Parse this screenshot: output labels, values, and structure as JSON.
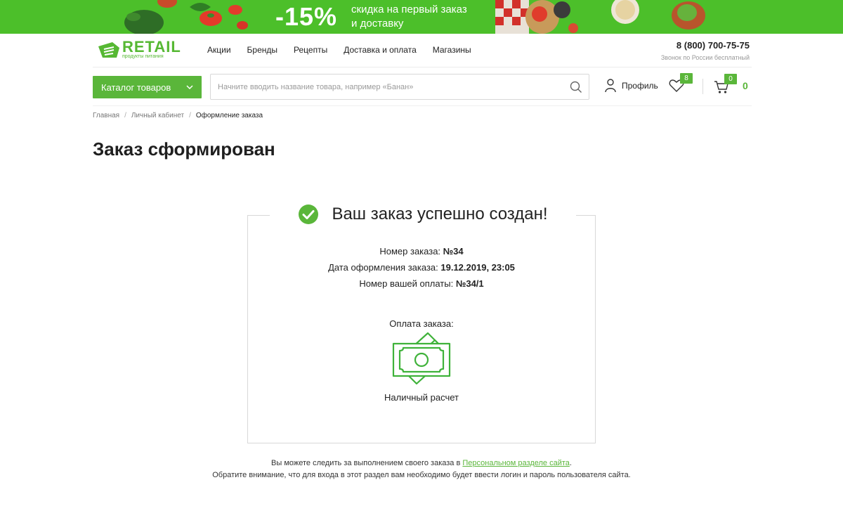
{
  "banner": {
    "discount": "-15%",
    "text_line1": "скидка на первый заказ",
    "text_line2": "и доставку"
  },
  "header": {
    "logo_name": "RETAIL",
    "logo_tagline": "продукты питания",
    "nav": [
      "Акции",
      "Бренды",
      "Рецепты",
      "Доставка и оплата",
      "Магазины"
    ],
    "phone": "8 (800) 700-75-75",
    "phone_note": "Звонок по России бесплатный"
  },
  "toolbar": {
    "catalog_label": "Каталог товаров",
    "search_placeholder": "Начните вводить название товара, например «Банан»",
    "profile_label": "Профиль",
    "favorites_count": "8",
    "cart_count": "0",
    "cart_total": "0"
  },
  "breadcrumb": [
    "Главная",
    "Личный кабинет",
    "Оформление заказа"
  ],
  "page_title": "Заказ сформирован",
  "order": {
    "success_title": "Ваш заказ успешно создан!",
    "number_label": "Номер заказа:",
    "number_value": "№34",
    "date_label": "Дата оформления заказа:",
    "date_value": "19.12.2019, 23:05",
    "payment_no_label": "Номер вашей оплаты:",
    "payment_no_value": "№34/1",
    "payment_label": "Оплата заказа:",
    "payment_method": "Наличный расчет"
  },
  "note": {
    "line1_before": "Вы можете следить за выполнением своего заказа в",
    "line1_link": "Персональном разделе сайта",
    "line1_after": ".",
    "line2": "Обратите внимание, что для входа в этот раздел вам необходимо будет ввести логин и пароль пользователя сайта."
  },
  "colors": {
    "brand_green": "#5ab63a",
    "banner_green": "#4cbf2a"
  },
  "icons": [
    "search-icon",
    "profile-icon",
    "heart-icon",
    "cart-icon",
    "check-circle-icon",
    "cash-icon",
    "chevron-down-icon"
  ]
}
